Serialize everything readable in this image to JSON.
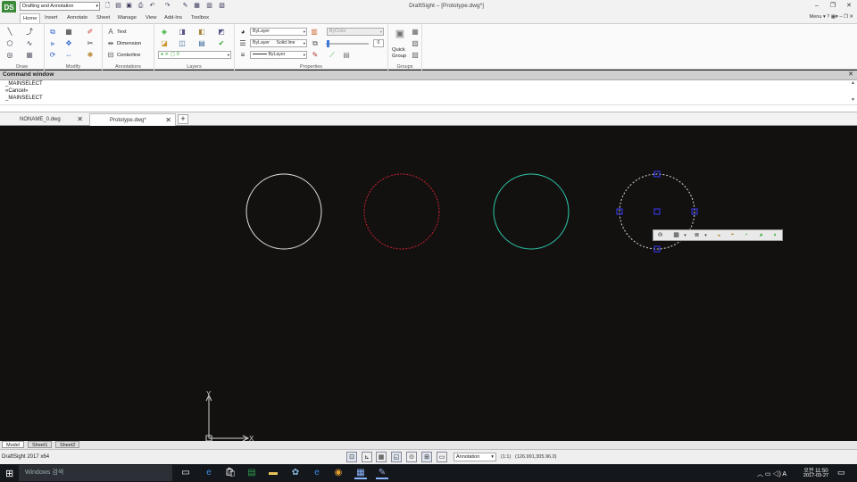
{
  "app": {
    "window_title": "DraftSight – [Prototype.dwg*]",
    "workspace": "Drafting and Annotation",
    "logo_text": "DS"
  },
  "menu_tabs": [
    "Home",
    "Insert",
    "Annotate",
    "Sheet",
    "Manage",
    "View",
    "Add-Ins",
    "Toolbox"
  ],
  "menu_right": "Menu",
  "ribbon": {
    "groups": {
      "draw": "Draw",
      "modify": "Modify",
      "annotations": "Annotations",
      "layers": "Layers",
      "properties": "Properties",
      "groups": "Groups"
    },
    "annotations": {
      "text": "Text",
      "dimension": "Dimension",
      "centerline": "Centerline"
    },
    "properties": {
      "color": "ByLayer",
      "linetype_layer": "ByLayer",
      "linetype": "Solid line",
      "lineweight": "ByLayer",
      "plot_style": "ByColor",
      "transparency": "0"
    },
    "groups_tool": {
      "quick": "Quick",
      "group": "Group"
    }
  },
  "command_window": {
    "title": "Command window",
    "lines": [
      "_MAINSELECT",
      "«Cancel»",
      "_MAINSELECT"
    ]
  },
  "doc_tabs": [
    "NONAME_0.dwg",
    "Prototype.dwg*"
  ],
  "layout_tabs": [
    "Model",
    "Sheet1",
    "Sheet2"
  ],
  "canvas": {
    "circles": [
      {
        "name": "white",
        "color": "#e0e0e0",
        "dashed": false
      },
      {
        "name": "red",
        "color": "#cc2233",
        "dashed": true
      },
      {
        "name": "cyan",
        "color": "#2ec7a8",
        "dashed": false
      },
      {
        "name": "selected",
        "color": "#d8d8d8",
        "dashed": true
      }
    ],
    "ucs_x": "X",
    "ucs_y": "Y"
  },
  "status": {
    "app": "DraftSight 2017 x64",
    "annotation": "Annotation",
    "scale": "(1:1)",
    "coords": "(126.991,305.96,0)"
  },
  "taskbar": {
    "search_placeholder": "Windows 검색",
    "time": "오전 11:50",
    "date": "2017-03-27",
    "lang": "A"
  },
  "colors": {
    "canvas_bg": "#121110",
    "grip": "#3b3bff",
    "ribbon_bg": "#fafafa",
    "taskbar": "#14171c"
  }
}
